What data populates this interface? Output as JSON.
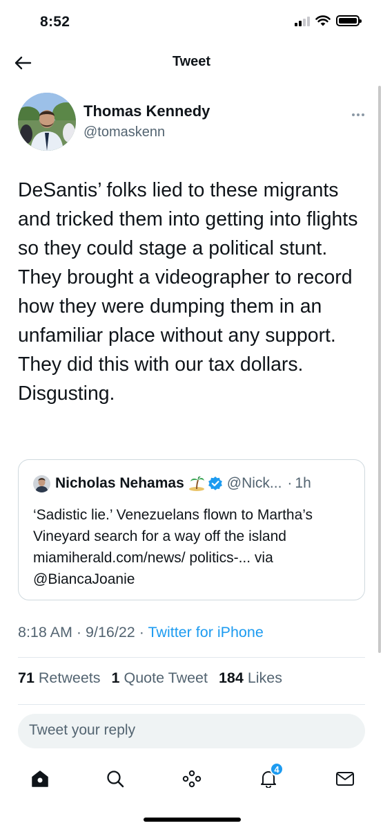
{
  "status_bar": {
    "time": "8:52"
  },
  "header": {
    "title": "Tweet"
  },
  "tweet": {
    "author_name": "Thomas Kennedy",
    "author_handle": "@tomaskenn",
    "text": "DeSantis’ folks lied to these migrants and tricked them into getting into flights so they could stage a political stunt. They brought a videographer to record how they were dumping them in an unfamiliar place without any support. They did this with our tax dollars. Disgusting.",
    "time": "8:18 AM",
    "date": "9/16/22",
    "source": "Twitter for iPhone"
  },
  "quote": {
    "author_name": "Nicholas Nehamas",
    "author_handle": "@Nick...",
    "time": "1h",
    "text": "‘Sadistic lie.’ Venezuelans flown to Martha’s Vineyard search for a way off the island miamiherald.com/news/ politics-... via @BiancaJoanie"
  },
  "stats": {
    "retweets_count": "71",
    "retweets_label": "Retweets",
    "quotes_count": "1",
    "quotes_label": "Quote Tweet",
    "likes_count": "184",
    "likes_label": "Likes"
  },
  "reply": {
    "placeholder": "Tweet your reply"
  },
  "tab_bar": {
    "tabs": [
      "home-icon",
      "search-icon",
      "spaces-icon",
      "notifications-icon",
      "messages-icon"
    ],
    "notifications_badge": "4"
  },
  "colors": {
    "accent": "#1d9bf0",
    "secondary_text": "#536471",
    "primary_text": "#0f1419"
  }
}
